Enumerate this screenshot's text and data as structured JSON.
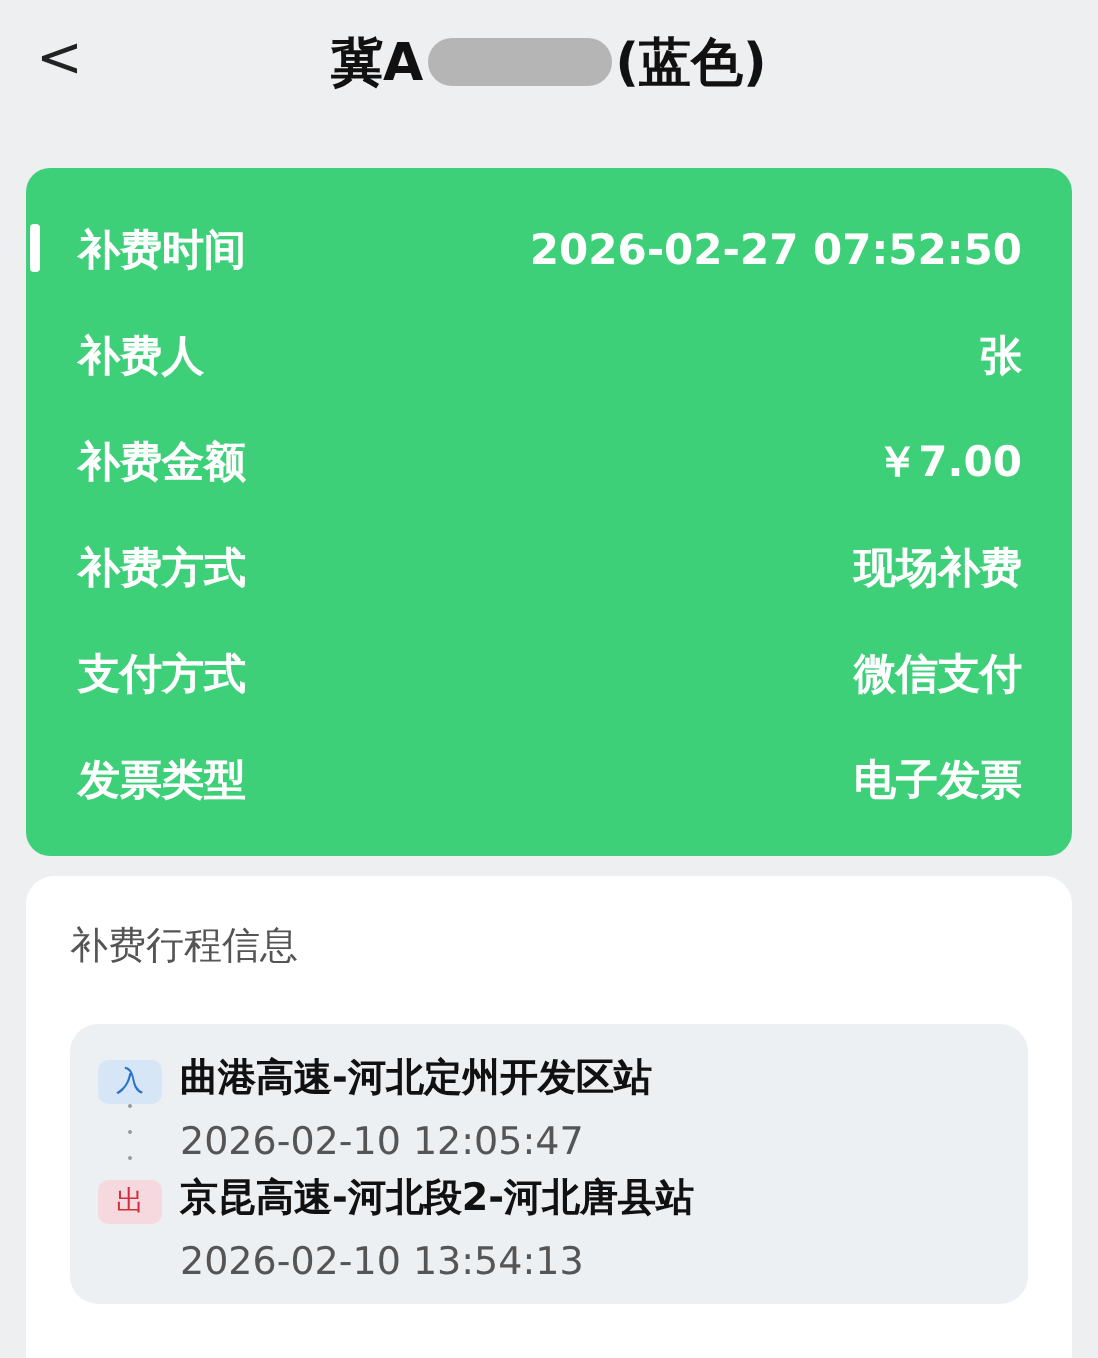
{
  "header": {
    "back": "<",
    "title_start": "冀A",
    "title_end": "(蓝色)"
  },
  "payment": {
    "rows": [
      {
        "label": "补费时间",
        "value": "2026-02-27 07:52:50",
        "selected": true
      },
      {
        "label": "补费人",
        "value": "张",
        "selected": false
      },
      {
        "label": "补费金额",
        "value": "￥7.00",
        "selected": false
      },
      {
        "label": "补费方式",
        "value": "现场补费",
        "selected": false
      },
      {
        "label": "支付方式",
        "value": "微信支付",
        "selected": false
      },
      {
        "label": "发票类型",
        "value": "电子发票",
        "selected": false
      }
    ]
  },
  "trip": {
    "title": "补费行程信息",
    "stops": [
      {
        "kind": "entry",
        "tag": "入",
        "station": "曲港高速-河北定州开发区站",
        "time": "2026-02-10 12:05:47"
      },
      {
        "kind": "exit",
        "tag": "出",
        "station": "京昆高速-河北段2-河北唐县站",
        "time": "2026-02-10 13:54:13"
      }
    ]
  }
}
